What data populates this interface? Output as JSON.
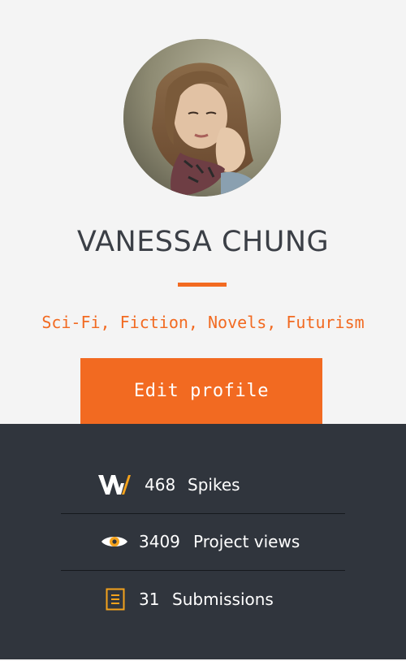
{
  "profile": {
    "name": "VANESSA CHUNG",
    "tags": "Sci-Fi, Fiction, Novels, Futurism",
    "edit_label": "Edit profile",
    "avatar_icon": "avatar-photo"
  },
  "stats": [
    {
      "icon": "spikes-logo-icon",
      "value": "468",
      "label": "Spikes"
    },
    {
      "icon": "eye-icon",
      "value": "3409",
      "label": "Project views"
    },
    {
      "icon": "document-icon",
      "value": "31",
      "label": "Submissions"
    }
  ],
  "colors": {
    "accent": "#f26a21",
    "panel": "#30353d",
    "background": "#f4f4f4",
    "name_text": "#3b3f46"
  }
}
